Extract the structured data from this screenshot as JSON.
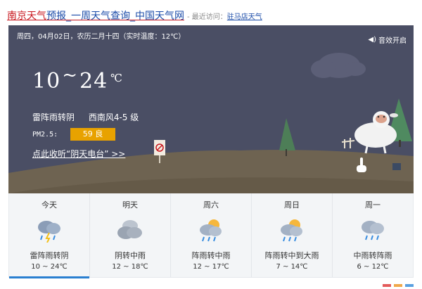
{
  "header": {
    "title_part1": "南京天气",
    "title_part2": "预报_一周天气查询_中国天气网",
    "visited_label": "- 最近访问：",
    "visited_link": "驻马店天气"
  },
  "today": {
    "date_line": "周四，04月02日，农历二月十四（实时温度：12℃）",
    "sound_label": "音效开启",
    "temp_low": "10",
    "temp_tilde": "~",
    "temp_high": "24",
    "temp_unit": "℃",
    "condition": "雷阵雨转阴",
    "wind": "西南风4-5 级",
    "pm_label": "PM2.5:",
    "pm_value": "59 良",
    "radio_link": "点此收听“阴天电台” >>"
  },
  "forecast": [
    {
      "day": "今天",
      "desc": "雷阵雨转阴",
      "temp": "10 ~ 24℃",
      "icon": "thunderstorm-icon",
      "active": true
    },
    {
      "day": "明天",
      "desc": "阴转中雨",
      "temp": "12 ~ 18℃",
      "icon": "overcast-icon",
      "active": false
    },
    {
      "day": "周六",
      "desc": "阵雨转中雨",
      "temp": "12 ~ 17℃",
      "icon": "shower-icon",
      "active": false
    },
    {
      "day": "周日",
      "desc": "阵雨转中到大雨",
      "temp": "7 ~ 14℃",
      "icon": "shower-icon",
      "active": false
    },
    {
      "day": "周一",
      "desc": "中雨转阵雨",
      "temp": "6 ~ 12℃",
      "icon": "rain-icon",
      "active": false
    }
  ],
  "colors": {
    "sky": "#4a4e64",
    "hill": "#6e6351",
    "pm_badge": "#e8a200",
    "title_red": "#c8161d",
    "link_blue": "#1a4ba8",
    "active_underline": "#2a7fd0"
  }
}
